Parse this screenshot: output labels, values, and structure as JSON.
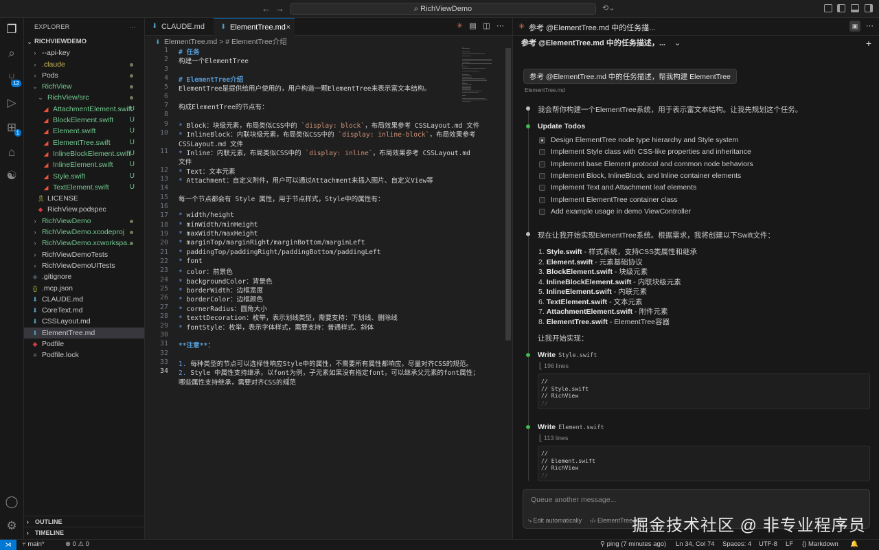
{
  "titlebar": {
    "search_text": "RichViewDemo",
    "back": "←",
    "forward": "→"
  },
  "activity": {
    "scm_badge": "12",
    "ext_badge": "1"
  },
  "explorer": {
    "title": "EXPLORER",
    "more": "···",
    "root": "RICHVIEWDEMO",
    "items": [
      {
        "name": "--api-key",
        "indent": 1,
        "type": "folder",
        "color": "#cccccc"
      },
      {
        "name": ".claude",
        "indent": 1,
        "type": "folder",
        "color": "#c9b45a",
        "dot": true
      },
      {
        "name": "Pods",
        "indent": 1,
        "type": "folder",
        "color": "#cccccc",
        "dot": true
      },
      {
        "name": "RichView",
        "indent": 1,
        "type": "folder-open",
        "color": "#73c991",
        "dot": true
      },
      {
        "name": "RichView/src",
        "indent": 2,
        "type": "folder-open",
        "color": "#73c991",
        "dot": true
      },
      {
        "name": "AttachmentElement.swift",
        "indent": 3,
        "type": "swift",
        "color": "#73c991",
        "status": "U"
      },
      {
        "name": "BlockElement.swift",
        "indent": 3,
        "type": "swift",
        "color": "#73c991",
        "status": "U"
      },
      {
        "name": "Element.swift",
        "indent": 3,
        "type": "swift",
        "color": "#73c991",
        "status": "U"
      },
      {
        "name": "ElementTree.swift",
        "indent": 3,
        "type": "swift",
        "color": "#73c991",
        "status": "U"
      },
      {
        "name": "InlineBlockElement.swift",
        "indent": 3,
        "type": "swift",
        "color": "#73c991",
        "status": "U"
      },
      {
        "name": "InlineElement.swift",
        "indent": 3,
        "type": "swift",
        "color": "#73c991",
        "status": "U"
      },
      {
        "name": "Style.swift",
        "indent": 3,
        "type": "swift",
        "color": "#73c991",
        "status": "U"
      },
      {
        "name": "TextElement.swift",
        "indent": 3,
        "type": "swift",
        "color": "#73c991",
        "status": "U"
      },
      {
        "name": "LICENSE",
        "indent": 2,
        "type": "license",
        "color": "#cccccc"
      },
      {
        "name": "RichView.podspec",
        "indent": 2,
        "type": "ruby",
        "color": "#cccccc"
      },
      {
        "name": "RichViewDemo",
        "indent": 1,
        "type": "folder",
        "color": "#73c991",
        "dot": true
      },
      {
        "name": "RichViewDemo.xcodeproj",
        "indent": 1,
        "type": "folder",
        "color": "#73c991",
        "dot": true
      },
      {
        "name": "RichViewDemo.xcworkspa...",
        "indent": 1,
        "type": "folder",
        "color": "#73c991",
        "dot": true
      },
      {
        "name": "RichViewDemoTests",
        "indent": 1,
        "type": "folder",
        "color": "#cccccc"
      },
      {
        "name": "RichViewDemoUITests",
        "indent": 1,
        "type": "folder",
        "color": "#cccccc"
      },
      {
        "name": ".gitignore",
        "indent": 1,
        "type": "git",
        "color": "#cccccc"
      },
      {
        "name": ".mcp.json",
        "indent": 1,
        "type": "json",
        "color": "#cccccc"
      },
      {
        "name": "CLAUDE.md",
        "indent": 1,
        "type": "md",
        "color": "#cccccc"
      },
      {
        "name": "CoreText.md",
        "indent": 1,
        "type": "md",
        "color": "#cccccc"
      },
      {
        "name": "CSSLayout.md",
        "indent": 1,
        "type": "md",
        "color": "#cccccc"
      },
      {
        "name": "ElementTree.md",
        "indent": 1,
        "type": "md",
        "color": "#cccccc",
        "selected": true
      },
      {
        "name": "Podfile",
        "indent": 1,
        "type": "ruby",
        "color": "#cccccc"
      },
      {
        "name": "Podfile.lock",
        "indent": 1,
        "type": "file",
        "color": "#cccccc"
      }
    ],
    "outline": "OUTLINE",
    "timeline": "TIMELINE"
  },
  "editor": {
    "tabs": [
      {
        "label": "CLAUDE.md",
        "active": false
      },
      {
        "label": "ElementTree.md",
        "active": true,
        "close": "×"
      }
    ],
    "breadcrumb": {
      "file": "ElementTree.md",
      "sep": ">",
      "section": "# ElementTree介绍"
    },
    "current_line": 34,
    "lines": [
      {
        "n": 1,
        "html": "<span class='h1'># 任务</span>"
      },
      {
        "n": 2,
        "html": "构建一个ElementTree"
      },
      {
        "n": 3,
        "html": ""
      },
      {
        "n": 4,
        "html": "<span class='h1'># ElementTree介绍</span>"
      },
      {
        "n": 5,
        "html": "ElementTree是提供给用户使用的，用户构造一颗ElementTree来表示富文本结构。"
      },
      {
        "n": 6,
        "html": ""
      },
      {
        "n": 7,
        "html": "构成ElementTree的节点有："
      },
      {
        "n": 8,
        "html": ""
      },
      {
        "n": 9,
        "html": "<span class='bullet'>*</span> Block：块级元素，布局类似CSS中的 <span class='codespan'>`display: block`</span>，布局效果参考 CSSLayout.md 文件"
      },
      {
        "n": 10,
        "html": "<span class='bullet'>*</span> InlineBlock：内联块级元素，布局类似CSS中的 <span class='codespan'>`display: inline-block`</span>，布局效果参考"
      },
      {
        "n": null,
        "html": "CSSLayout.md 文件"
      },
      {
        "n": 11,
        "html": "<span class='bullet'>*</span> Inline：内联元素，布局类似CSS中的 <span class='codespan'>`display: inline`</span>，布局效果参考 CSSLayout.md"
      },
      {
        "n": null,
        "html": "文件"
      },
      {
        "n": 12,
        "html": "<span class='bullet'>*</span> Text：文本元素"
      },
      {
        "n": 13,
        "html": "<span class='bullet'>*</span> Attachment：自定义附件，用户可以通过Attachment来插入图片、自定义View等"
      },
      {
        "n": 14,
        "html": ""
      },
      {
        "n": 15,
        "html": "每一个节点都会有 Style 属性，用于节点样式，Style中的属性有："
      },
      {
        "n": 16,
        "html": ""
      },
      {
        "n": 17,
        "html": "<span class='bullet'>*</span> width/height"
      },
      {
        "n": 18,
        "html": "<span class='bullet'>*</span> minWidth/minHeight"
      },
      {
        "n": 19,
        "html": "<span class='bullet'>*</span> maxWidth/maxHeight"
      },
      {
        "n": 20,
        "html": "<span class='bullet'>*</span> marginTop/marginRight/marginBottom/marginLeft"
      },
      {
        "n": 21,
        "html": "<span class='bullet'>*</span> paddingTop/paddingRight/paddingBottom/paddingLeft"
      },
      {
        "n": 22,
        "html": "<span class='bullet'>*</span> font"
      },
      {
        "n": 23,
        "html": "<span class='bullet'>*</span> color：前景色"
      },
      {
        "n": 24,
        "html": "<span class='bullet'>*</span> backgroundColor：背景色"
      },
      {
        "n": 25,
        "html": "<span class='bullet'>*</span> borderWidth：边框宽度"
      },
      {
        "n": 26,
        "html": "<span class='bullet'>*</span> borderColor：边框颜色"
      },
      {
        "n": 27,
        "html": "<span class='bullet'>*</span> cornerRadius：圆角大小"
      },
      {
        "n": 28,
        "html": "<span class='bullet'>*</span> texttDecoration：枚举，表示划线类型，需要支持：下划线、删除线"
      },
      {
        "n": 29,
        "html": "<span class='bullet'>*</span> fontStyle：枚举，表示字体样式，需要支持：普通样式、斜体"
      },
      {
        "n": 30,
        "html": ""
      },
      {
        "n": 31,
        "html": "<span class='h1'>**注意**</span>："
      },
      {
        "n": 32,
        "html": ""
      },
      {
        "n": 33,
        "html": "<span class='bullet'>1.</span> 每种类型的节点可以选择性响应Style中的属性，不需要所有属性都响应，尽量对齐CSS的规范。"
      },
      {
        "n": 34,
        "html": "<span class='bullet'>2.</span> Style 中属性支持继承，以font为例，子元素如果没有指定font，可以继承父元素的font属性；"
      },
      {
        "n": null,
        "html": "哪些属性支持继承，需要对齐CSS的规范"
      }
    ]
  },
  "chat": {
    "tab_title": "参考 @ElementTree.md 中的任务描...",
    "tab_close": "×",
    "subhead": "参考 @ElementTree.md 中的任务描述，...",
    "subhead_chevron": "⌄",
    "new_chat": "+",
    "user_message": "参考 @ElementTree.md 中的任务描述，帮我构建 ElementTree",
    "user_context": "ElementTree.md",
    "intro": "我会帮你构建一个ElementTree系统，用于表示富文本结构。让我先规划这个任务。",
    "todos_title": "Update Todos",
    "todos": [
      {
        "text": "Design ElementTree node type hierarchy and Style system",
        "state": "in-progress"
      },
      {
        "text": "Implement Style class with CSS-like properties and inheritance",
        "state": "pending"
      },
      {
        "text": "Implement base Element protocol and common node behaviors",
        "state": "pending"
      },
      {
        "text": "Implement Block, InlineBlock, and Inline container elements",
        "state": "pending"
      },
      {
        "text": "Implement Text and Attachment leaf elements",
        "state": "pending"
      },
      {
        "text": "Implement ElementTree container class",
        "state": "pending"
      },
      {
        "text": "Add example usage in demo ViewController",
        "state": "pending"
      }
    ],
    "plan_intro": "现在让我开始实现ElementTree系统。根据需求，我将创建以下Swift文件：",
    "plan": [
      {
        "num": "1.",
        "file": "Style.swift",
        "desc": " - 样式系统，支持CSS类属性和继承"
      },
      {
        "num": "2.",
        "file": "Element.swift",
        "desc": " - 元素基础协议"
      },
      {
        "num": "3.",
        "file": "BlockElement.swift",
        "desc": " - 块级元素"
      },
      {
        "num": "4.",
        "file": "InlineBlockElement.swift",
        "desc": " - 内联块级元素"
      },
      {
        "num": "5.",
        "file": "InlineElement.swift",
        "desc": " - 内联元素"
      },
      {
        "num": "6.",
        "file": "TextElement.swift",
        "desc": " - 文本元素"
      },
      {
        "num": "7.",
        "file": "AttachmentElement.swift",
        "desc": " - 附件元素"
      },
      {
        "num": "8.",
        "file": "ElementTree.swift",
        "desc": " - ElementTree容器"
      }
    ],
    "start": "让我开始实现：",
    "writes": [
      {
        "label": "Write",
        "file": "Style.swift",
        "lines": "196 lines",
        "code": [
          "//",
          "//  Style.swift",
          "//  RichView",
          "//"
        ]
      },
      {
        "label": "Write",
        "file": "Element.swift",
        "lines": "113 lines",
        "code": [
          "//",
          "//  Element.swift",
          "//  RichView",
          "//"
        ]
      }
    ],
    "input_placeholder": "Queue another message...",
    "edit_mode": "Edit automatically",
    "context_file": "ElementTree.md"
  },
  "statusbar": {
    "branch": "main*",
    "problems": "⊗ 0 ⚠ 0",
    "ping": "ping (7 minutes ago)",
    "position": "Ln 34, Col 74",
    "spaces": "Spaces: 4",
    "encoding": "UTF-8",
    "eol": "LF",
    "language": "Markdown"
  },
  "watermark": "掘金技术社区 @ 非专业程序员"
}
